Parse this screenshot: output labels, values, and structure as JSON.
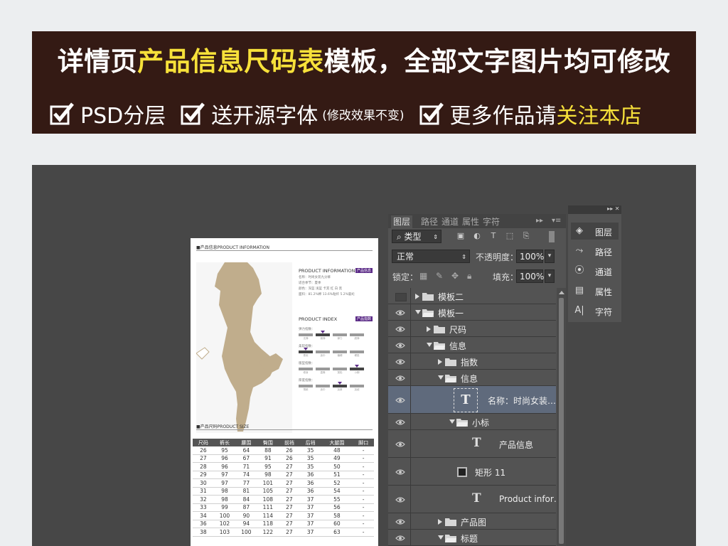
{
  "banner": {
    "title_pre": "详情页",
    "title_highlight": "产品信息尺码表",
    "title_post": "模板，全部文字图片均可修改",
    "features": [
      {
        "text": "PSD分层"
      },
      {
        "text": "送开源字体",
        "note": "(修改效果不变)"
      },
      {
        "text": "更多作品请",
        "highlight": "关注本店"
      }
    ],
    "accent_color": "#f7e13a",
    "bg_color": "#341a14"
  },
  "document": {
    "section1_title": "■产品信息PRODUCT INFORMATION",
    "info_title": "PRODUCT INFORMATION",
    "info_badge": "产品信息",
    "info_lines": [
      "名称：时尚女装九分裤",
      "适合季节：夏季",
      "颜色：深蓝 浅蓝 卡其 红 白 黑",
      "面料：81.2%棉 13.6%粘纤 5.2%氨纶"
    ],
    "index_title": "PRODUCT INDEX",
    "index_badge": "产品指数",
    "indices": [
      {
        "label": "弹力指数：",
        "options": [
          "无弹",
          "微弹",
          "弹力",
          "超弹"
        ],
        "selected": 1
      },
      {
        "label": "柔软指数：",
        "options": [
          "柔软",
          "适中",
          "偏硬",
          "硬挺"
        ],
        "selected": 0
      },
      {
        "label": "版型指数：",
        "options": [
          "修身",
          "直筒",
          "宽松",
          "小脚"
        ],
        "selected": 3
      },
      {
        "label": "厚度指数：",
        "options": [
          "薄款",
          "适中",
          "加厚",
          "加绒"
        ],
        "selected": 2
      }
    ],
    "section2_title": "■产品尺码PRODUCT SIZE",
    "size_table": {
      "headers": [
        "尺码",
        "裤长",
        "腰围",
        "臀围",
        "前裆",
        "后裆",
        "大腿围",
        "脚口"
      ],
      "rows": [
        [
          "26",
          "95",
          "64",
          "88",
          "26",
          "35",
          "48",
          "-"
        ],
        [
          "27",
          "96",
          "67",
          "91",
          "26",
          "35",
          "49",
          "-"
        ],
        [
          "28",
          "96",
          "71",
          "95",
          "27",
          "35",
          "50",
          "-"
        ],
        [
          "29",
          "97",
          "74",
          "98",
          "27",
          "36",
          "51",
          "-"
        ],
        [
          "30",
          "97",
          "77",
          "101",
          "27",
          "36",
          "52",
          "-"
        ],
        [
          "31",
          "98",
          "81",
          "105",
          "27",
          "36",
          "54",
          "-"
        ],
        [
          "32",
          "98",
          "84",
          "108",
          "27",
          "37",
          "55",
          "-"
        ],
        [
          "33",
          "99",
          "87",
          "111",
          "27",
          "37",
          "56",
          "-"
        ],
        [
          "34",
          "100",
          "90",
          "114",
          "27",
          "37",
          "58",
          "-"
        ],
        [
          "36",
          "102",
          "94",
          "118",
          "27",
          "37",
          "60",
          "-"
        ],
        [
          "38",
          "103",
          "100",
          "122",
          "27",
          "37",
          "63",
          "-"
        ]
      ]
    }
  },
  "layers_panel": {
    "tabs": [
      "图层",
      "路径",
      "通道",
      "属性",
      "字符"
    ],
    "filter_label": "类型",
    "blend_mode": "正常",
    "opacity_label": "不透明度：",
    "opacity_value": "100%",
    "lock_label": "锁定：",
    "fill_label": "填充：",
    "fill_value": "100%",
    "layers": [
      {
        "name": "模板二",
        "kind": "folder",
        "depth": 0,
        "expanded": false,
        "visible": false
      },
      {
        "name": "模板一",
        "kind": "folder",
        "depth": 0,
        "expanded": true,
        "visible": true
      },
      {
        "name": "尺码",
        "kind": "folder",
        "depth": 1,
        "expanded": false,
        "visible": true
      },
      {
        "name": "信息",
        "kind": "folder",
        "depth": 1,
        "expanded": true,
        "visible": true
      },
      {
        "name": "指数",
        "kind": "folder",
        "depth": 2,
        "expanded": false,
        "visible": true
      },
      {
        "name": "信息",
        "kind": "folder",
        "depth": 2,
        "expanded": true,
        "visible": true
      },
      {
        "name": "名称：时尚女装…",
        "kind": "text",
        "depth": 3,
        "visible": true,
        "selected": true
      },
      {
        "name": "小标",
        "kind": "folder",
        "depth": 3,
        "expanded": true,
        "visible": true
      },
      {
        "name": "产品信息",
        "kind": "text",
        "depth": 4,
        "visible": true
      },
      {
        "name": "矩形 11",
        "kind": "shape",
        "depth": 4,
        "visible": true
      },
      {
        "name": "Product infor…",
        "kind": "text",
        "depth": 4,
        "visible": true
      },
      {
        "name": "产品图",
        "kind": "folder",
        "depth": 2,
        "expanded": false,
        "visible": true
      },
      {
        "name": "标题",
        "kind": "folder",
        "depth": 2,
        "expanded": true,
        "visible": true
      }
    ]
  },
  "collapsed_panel": {
    "items": [
      {
        "label": "图层",
        "icon": "layers-icon"
      },
      {
        "label": "路径",
        "icon": "paths-icon"
      },
      {
        "label": "通道",
        "icon": "channels-icon"
      },
      {
        "label": "属性",
        "icon": "properties-icon"
      },
      {
        "label": "字符",
        "icon": "character-icon"
      }
    ]
  }
}
